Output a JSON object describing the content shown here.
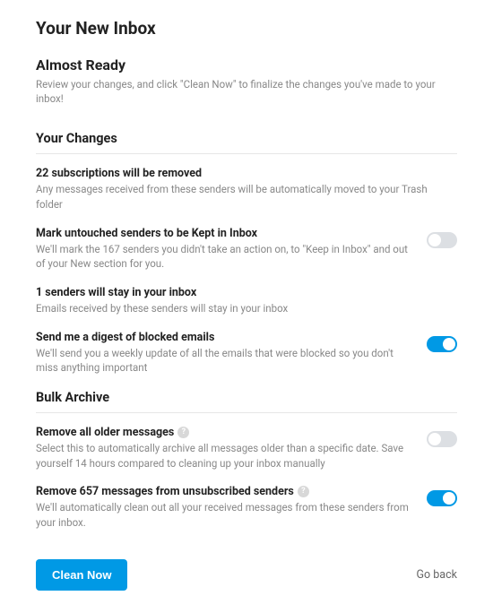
{
  "page_title": "Your New Inbox",
  "ready": {
    "heading": "Almost Ready",
    "subtitle": "Review your changes, and click \"Clean Now\" to finalize the changes you've made to your inbox!"
  },
  "changes": {
    "heading": "Your Changes",
    "items": [
      {
        "title": "22 subscriptions will be removed",
        "desc": "Any messages received from these senders will be automatically moved to your Trash folder",
        "has_toggle": false
      },
      {
        "title": "Mark untouched senders to be Kept in Inbox",
        "desc": "We'll mark the 167 senders you didn't take an action on, to \"Keep in Inbox\" and out of your New section for you.",
        "has_toggle": true,
        "toggle_on": false
      },
      {
        "title": "1 senders will stay in your inbox",
        "desc": "Emails received by these senders will stay in your inbox",
        "has_toggle": false
      },
      {
        "title": "Send me a digest of blocked emails",
        "desc": "We'll send you a weekly update of all the emails that were blocked so you don't miss anything important",
        "has_toggle": true,
        "toggle_on": true
      }
    ]
  },
  "bulk": {
    "heading": "Bulk Archive",
    "items": [
      {
        "title": "Remove all older messages",
        "desc": "Select this to automatically archive all messages older than a specific date. Save yourself 14 hours compared to cleaning up your inbox manually",
        "help": true,
        "toggle_on": false
      },
      {
        "title": "Remove 657 messages from unsubscribed senders",
        "desc": "We'll automatically clean out all your received messages from these senders from your inbox.",
        "help": true,
        "toggle_on": true
      }
    ]
  },
  "footer": {
    "primary": "Clean Now",
    "back": "Go back"
  }
}
